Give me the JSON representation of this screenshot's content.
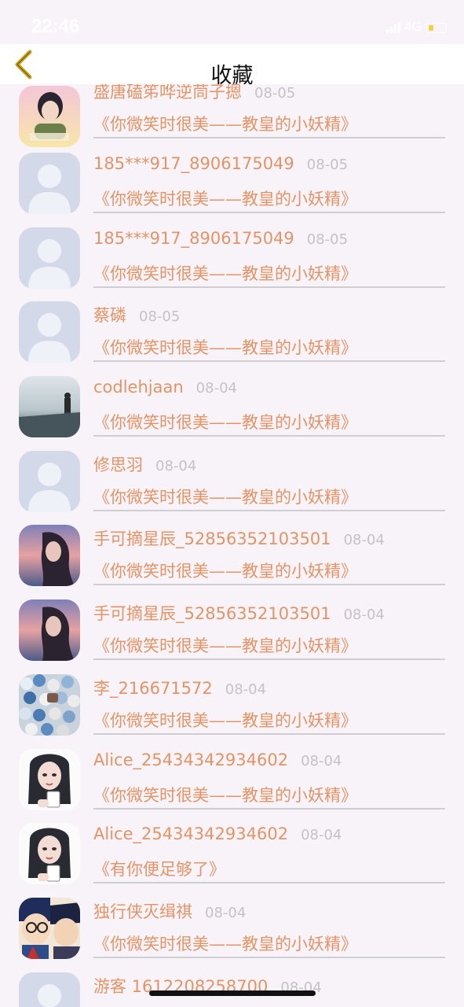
{
  "status": {
    "time": "22:46",
    "network": "4G",
    "battery_color": "#f4d23a"
  },
  "nav": {
    "title": "收藏",
    "back_icon": "chevron-left-icon",
    "back_color": "#c9a21a"
  },
  "items": [
    {
      "name": "盛唐磕笫哗逆茼子摁",
      "date": "08-05",
      "text": "《你微笑时很美——教皇的小妖精》",
      "avatar": "photo-girl-pink"
    },
    {
      "name": "185***917_8906175049",
      "date": "08-05",
      "text": "《你微笑时很美——教皇的小妖精》",
      "avatar": "default-person"
    },
    {
      "name": "185***917_8906175049",
      "date": "08-05",
      "text": "《你微笑时很美——教皇的小妖精》",
      "avatar": "default-person"
    },
    {
      "name": "蔡磷",
      "date": "08-05",
      "text": "《你微笑时很美——教皇的小妖精》",
      "avatar": "default-person"
    },
    {
      "name": "codlehjaan",
      "date": "08-04",
      "text": "《你微笑时很美——教皇的小妖精》",
      "avatar": "photo-sea"
    },
    {
      "name": "修思羽",
      "date": "08-04",
      "text": "《你微笑时很美——教皇的小妖精》",
      "avatar": "default-person"
    },
    {
      "name": "手可摘星辰_52856352103501",
      "date": "08-04",
      "text": "《你微笑时很美——教皇的小妖精》",
      "avatar": "photo-girl-sunset"
    },
    {
      "name": "手可摘星辰_52856352103501",
      "date": "08-04",
      "text": "《你微笑时很美——教皇的小妖精》",
      "avatar": "photo-girl-sunset"
    },
    {
      "name": "李_216671572",
      "date": "08-04",
      "text": "《你微笑时很美——教皇的小妖精》",
      "avatar": "photo-balls"
    },
    {
      "name": "Alice_25434342934602",
      "date": "08-04",
      "text": "《你微笑时很美——教皇的小妖精》",
      "avatar": "illustration-girl"
    },
    {
      "name": "Alice_25434342934602",
      "date": "08-04",
      "text": "《有你便足够了》",
      "avatar": "illustration-girl"
    },
    {
      "name": "独行侠灭缉祺",
      "date": "08-04",
      "text": "《你微笑时很美——教皇的小妖精》",
      "avatar": "anime-detective"
    },
    {
      "name": "游客 1612208258700",
      "date": "08-04",
      "text": "",
      "avatar": "default-person"
    }
  ],
  "colors": {
    "accent_text": "#e29466",
    "date_text": "#c5c2c6",
    "background": "#f7f3f8",
    "divider": "#cfcfd2"
  }
}
